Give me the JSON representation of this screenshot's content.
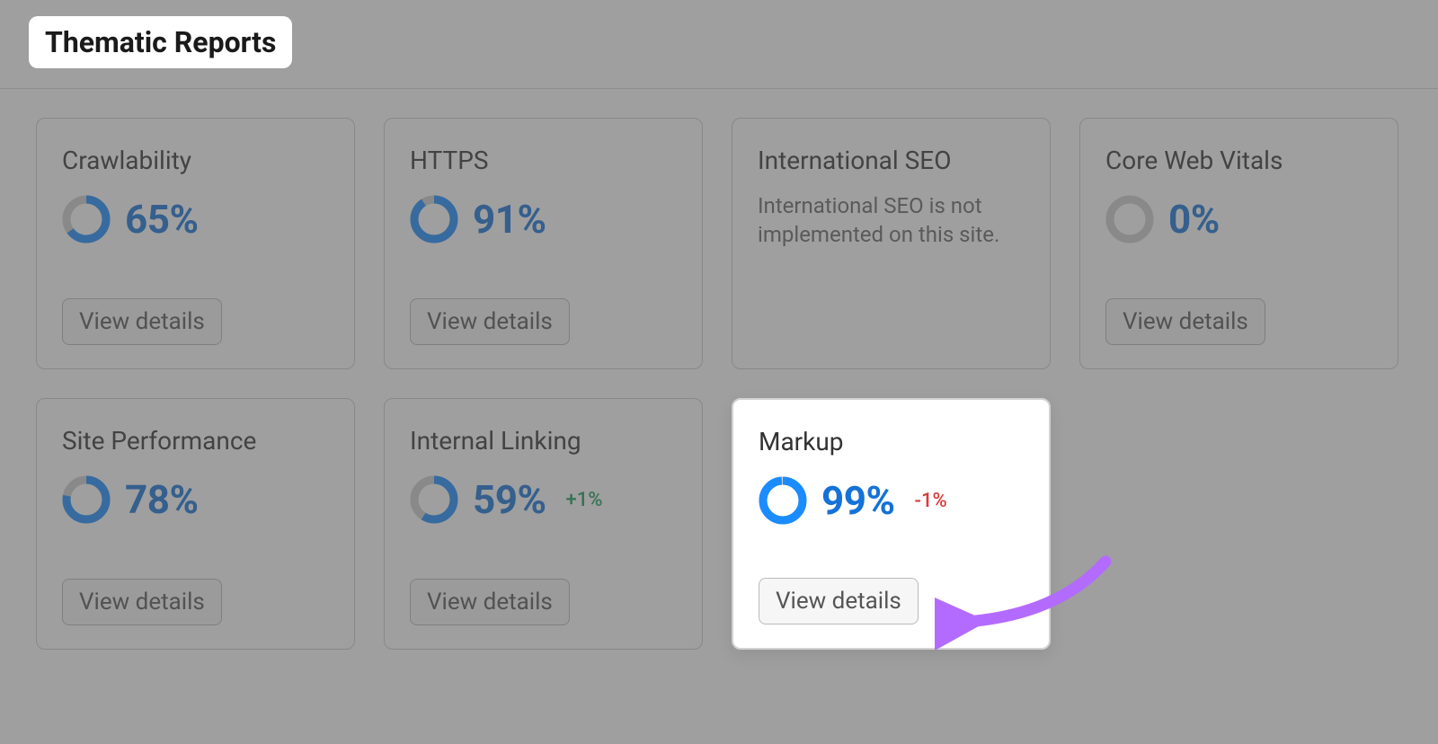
{
  "header": {
    "title": "Thematic Reports"
  },
  "labels": {
    "view_details": "View details"
  },
  "colors": {
    "accent": "#1a8cff",
    "accent_dark": "#1472d8",
    "ring_bg": "#cfcfcf",
    "delta_up": "#1a9e5a",
    "delta_down": "#d93a3a",
    "arrow": "#b36bff"
  },
  "cards": [
    {
      "id": "crawlability",
      "title": "Crawlability",
      "pct": 65,
      "pct_label": "65%",
      "delta": null,
      "msg": null,
      "highlight": false,
      "has_metric": true,
      "has_button": true
    },
    {
      "id": "https",
      "title": "HTTPS",
      "pct": 91,
      "pct_label": "91%",
      "delta": null,
      "msg": null,
      "highlight": false,
      "has_metric": true,
      "has_button": true
    },
    {
      "id": "intl-seo",
      "title": "International SEO",
      "pct": null,
      "pct_label": null,
      "delta": null,
      "msg": "International SEO is not implemented on this site.",
      "highlight": false,
      "has_metric": false,
      "has_button": false
    },
    {
      "id": "core-web-vitals",
      "title": "Core Web Vitals",
      "pct": 0,
      "pct_label": "0%",
      "delta": null,
      "msg": null,
      "highlight": false,
      "has_metric": true,
      "has_button": true
    },
    {
      "id": "site-performance",
      "title": "Site Performance",
      "pct": 78,
      "pct_label": "78%",
      "delta": null,
      "msg": null,
      "highlight": false,
      "has_metric": true,
      "has_button": true
    },
    {
      "id": "internal-linking",
      "title": "Internal Linking",
      "pct": 59,
      "pct_label": "59%",
      "delta": "+1%",
      "delta_dir": "up",
      "msg": null,
      "highlight": false,
      "has_metric": true,
      "has_button": true
    },
    {
      "id": "markup",
      "title": "Markup",
      "pct": 99,
      "pct_label": "99%",
      "delta": "-1%",
      "delta_dir": "down",
      "msg": null,
      "highlight": true,
      "has_metric": true,
      "has_button": true
    }
  ]
}
